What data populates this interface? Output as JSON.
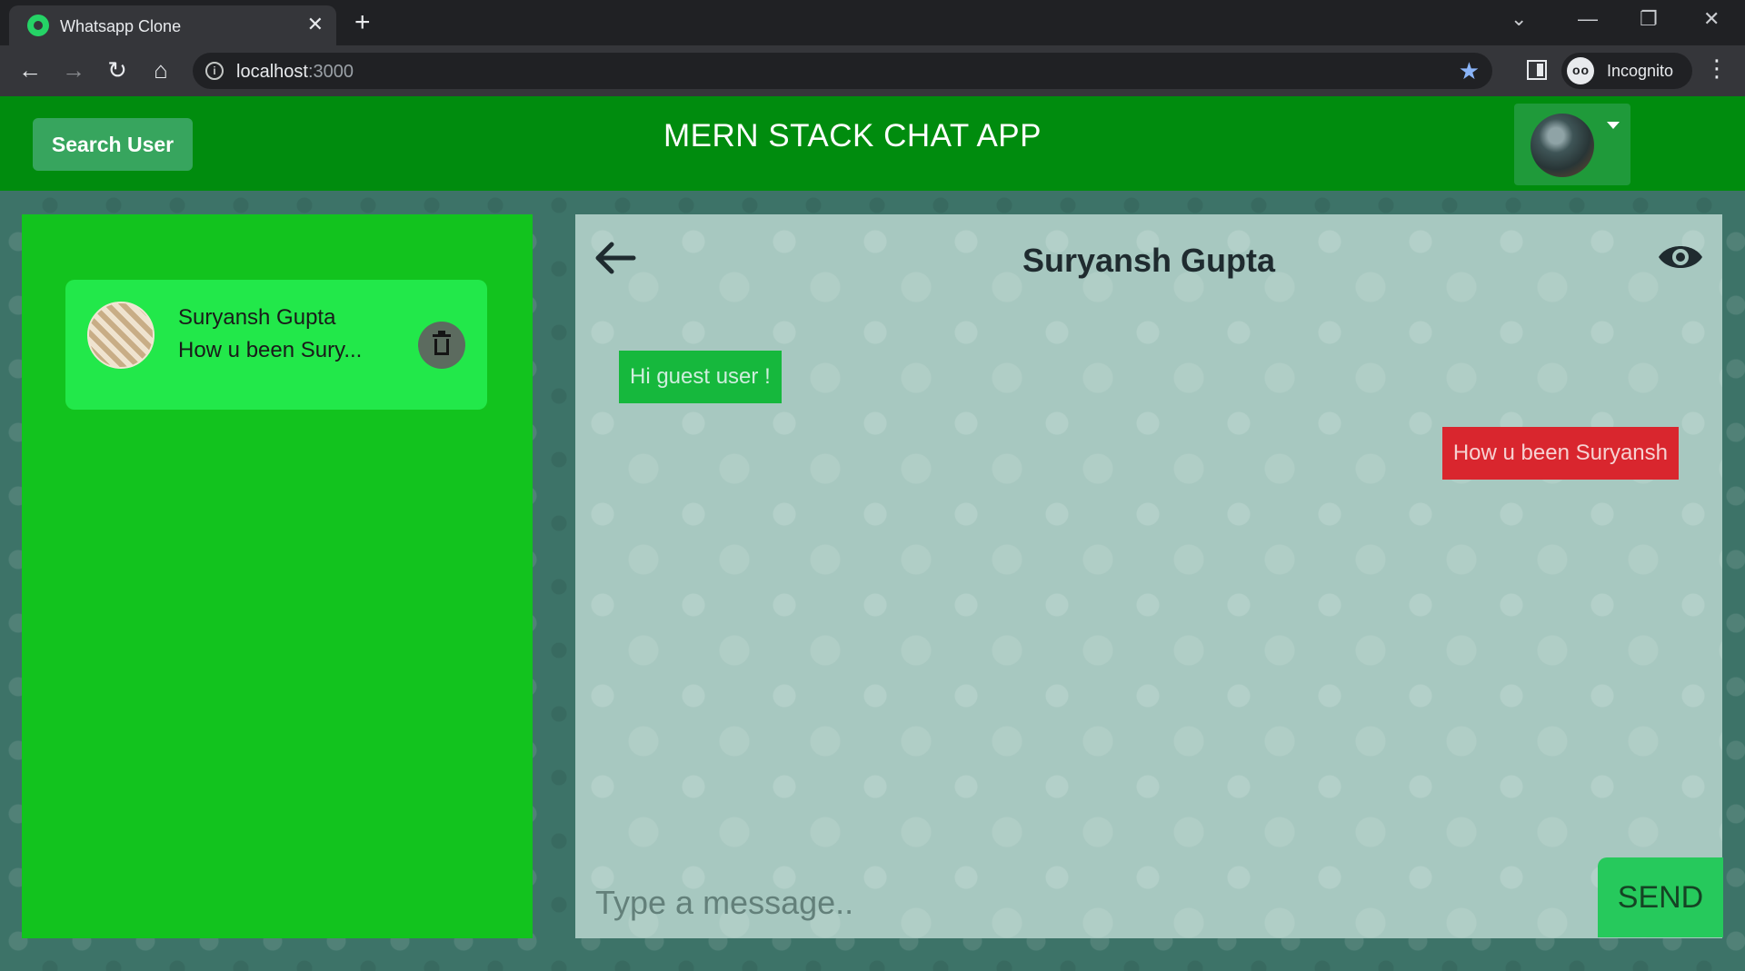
{
  "browser": {
    "tab_title": "Whatsapp Clone",
    "tab_close": "✕",
    "new_tab": "+",
    "url_host": "localhost",
    "url_port": ":3000",
    "profile_label": "Incognito",
    "icons": [
      "whatsapp-favicon",
      "back-icon",
      "forward-icon",
      "reload-icon",
      "home-icon",
      "info-icon",
      "star-icon",
      "side-panel-icon",
      "incognito-icon",
      "menu-icon"
    ]
  },
  "header": {
    "search_button": "Search User",
    "title": "MERN STACK CHAT APP"
  },
  "sidebar": {
    "chats": [
      {
        "name": "Suryansh Gupta",
        "last_message": "How u been Sury..."
      }
    ]
  },
  "chat": {
    "title": "Suryansh Gupta",
    "messages": [
      {
        "text": "Hi guest user !",
        "direction": "incoming"
      },
      {
        "text": "How u been Suryansh",
        "direction": "outgoing"
      }
    ],
    "input_placeholder": "Type a message..",
    "send_button": "SEND"
  },
  "colors": {
    "header_bg": "#008c0e",
    "sidebar_bg": "#12c31e",
    "card_bg": "#22e84a",
    "incoming_bubble": "#16b83d",
    "outgoing_bubble": "#d9262e",
    "send_button": "#26c95c"
  }
}
